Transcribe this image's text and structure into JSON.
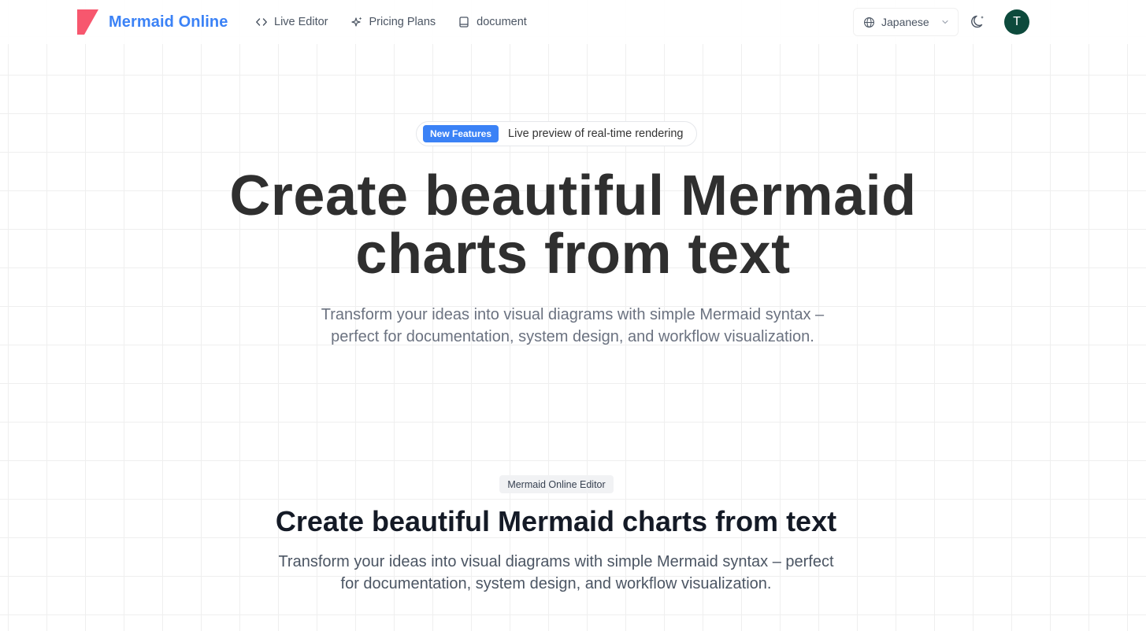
{
  "header": {
    "brand_name": "Mermaid Online",
    "nav": [
      {
        "label": "Live Editor",
        "icon": "code-icon"
      },
      {
        "label": "Pricing Plans",
        "icon": "sparkles-icon"
      },
      {
        "label": "document",
        "icon": "book-icon"
      }
    ],
    "language": {
      "selected": "Japanese",
      "icon": "globe-icon"
    },
    "theme_toggle_icon": "moon-icon",
    "avatar_initial": "T"
  },
  "hero": {
    "badge": "New Features",
    "badge_text": "Live preview of real-time rendering",
    "title_line1": "Create beautiful Mermaid",
    "title_line2": "charts from text",
    "subtitle_line1": "Transform your ideas into visual diagrams with simple Mermaid syntax –",
    "subtitle_line2": "perfect for documentation, system design, and workflow visualization."
  },
  "section": {
    "tag": "Mermaid Online Editor",
    "title": "Create beautiful Mermaid charts from text",
    "subtitle_line1": "Transform your ideas into visual diagrams with simple Mermaid syntax – perfect",
    "subtitle_line2": "for documentation, system design, and workflow visualization."
  },
  "colors": {
    "accent": "#3b82f6",
    "logo": "#f43f5e",
    "avatar": "#0d4a3c"
  }
}
